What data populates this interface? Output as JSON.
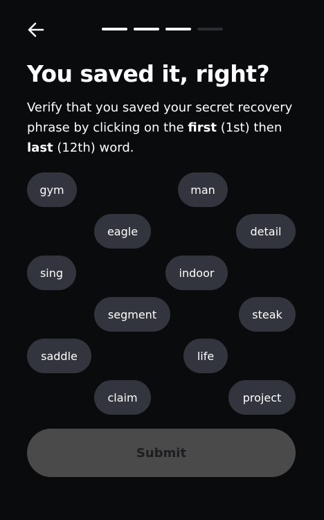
{
  "header": {
    "back_icon": "arrow-left-icon",
    "progress": {
      "total_steps": 4,
      "completed_steps": 3
    }
  },
  "title": "You saved it, right?",
  "description": {
    "part1": "Verify that you saved your secret recovery phrase by clicking on the ",
    "bold1": "first",
    "part2": " (1st) then ",
    "bold2": "last",
    "part3": " (12th) word."
  },
  "words": [
    "gym",
    "man",
    "eagle",
    "detail",
    "sing",
    "indoor",
    "segment",
    "steak",
    "saddle",
    "life",
    "claim",
    "project"
  ],
  "submit_label": "Submit",
  "colors": {
    "background": "#0a0b0d",
    "chip": "#32353d",
    "submit_disabled": "#4a4a4a",
    "submit_text_disabled": "#1d1e21",
    "progress_active": "#ffffff",
    "progress_inactive": "#2b2d33"
  }
}
